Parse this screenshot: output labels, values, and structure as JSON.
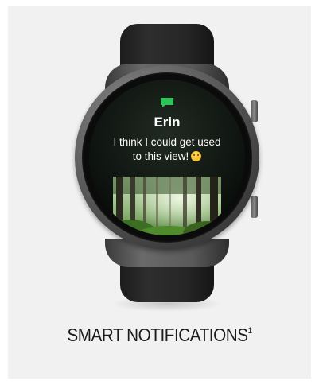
{
  "notification": {
    "sender": "Erin",
    "message": "I think I could get used to this view!"
  },
  "caption": {
    "title": "SMART NOTIFICATIONS",
    "footnote": "1"
  },
  "icons": {
    "app": "message-bubble-icon",
    "emoji": "smiling-face-emoji-icon"
  },
  "colors": {
    "background_panel": "#f1f1f1",
    "message_icon": "#2fc45a",
    "strap": "#262626",
    "case": "#5e5e5e",
    "caption_text": "#1b1b1b"
  }
}
